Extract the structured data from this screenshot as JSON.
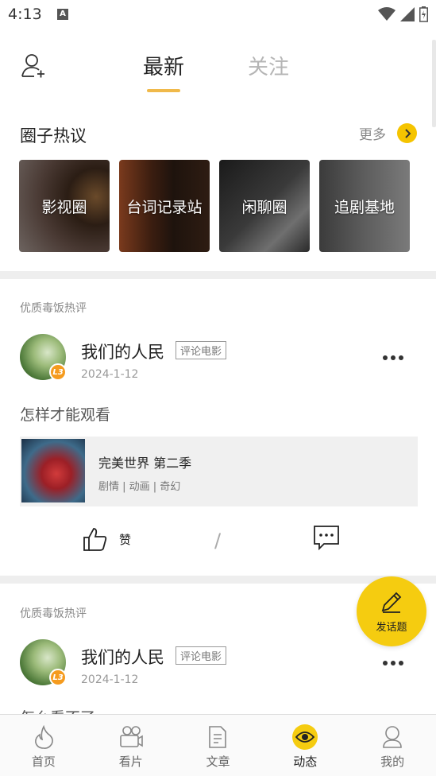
{
  "status_bar": {
    "time": "4:13",
    "notif_badge": "A"
  },
  "top_nav": {
    "tabs": [
      {
        "label": "最新",
        "active": true
      },
      {
        "label": "关注",
        "active": false
      }
    ]
  },
  "circles": {
    "title": "圈子热议",
    "more_label": "更多",
    "items": [
      {
        "label": "影视圈"
      },
      {
        "label": "台词记录站"
      },
      {
        "label": "闲聊圈"
      },
      {
        "label": "追剧基地"
      }
    ]
  },
  "posts": [
    {
      "category": "优质毒饭热评",
      "user": "我们的人民",
      "badge": "L3",
      "tag": "评论电影",
      "date": "2024-1-12",
      "text": "怎样才能观看",
      "work": {
        "title": "完美世界 第二季",
        "genres": "剧情 | 动画 | 奇幻"
      },
      "like_label": "赞"
    },
    {
      "category": "优质毒饭热评",
      "user": "我们的人民",
      "badge": "L3",
      "tag": "评论电影",
      "date": "2024-1-12",
      "text": "怎么看不了"
    }
  ],
  "fab": {
    "label": "发话题"
  },
  "bottom_nav": {
    "items": [
      {
        "label": "首页",
        "icon": "flame-icon"
      },
      {
        "label": "看片",
        "icon": "camera-icon"
      },
      {
        "label": "文章",
        "icon": "document-icon"
      },
      {
        "label": "动态",
        "icon": "eye-icon",
        "active": true
      },
      {
        "label": "我的",
        "icon": "user-icon"
      }
    ]
  },
  "colors": {
    "accent": "#f5cc10",
    "tab_underline": "#f0b94a",
    "badge": "#f59b1e"
  }
}
